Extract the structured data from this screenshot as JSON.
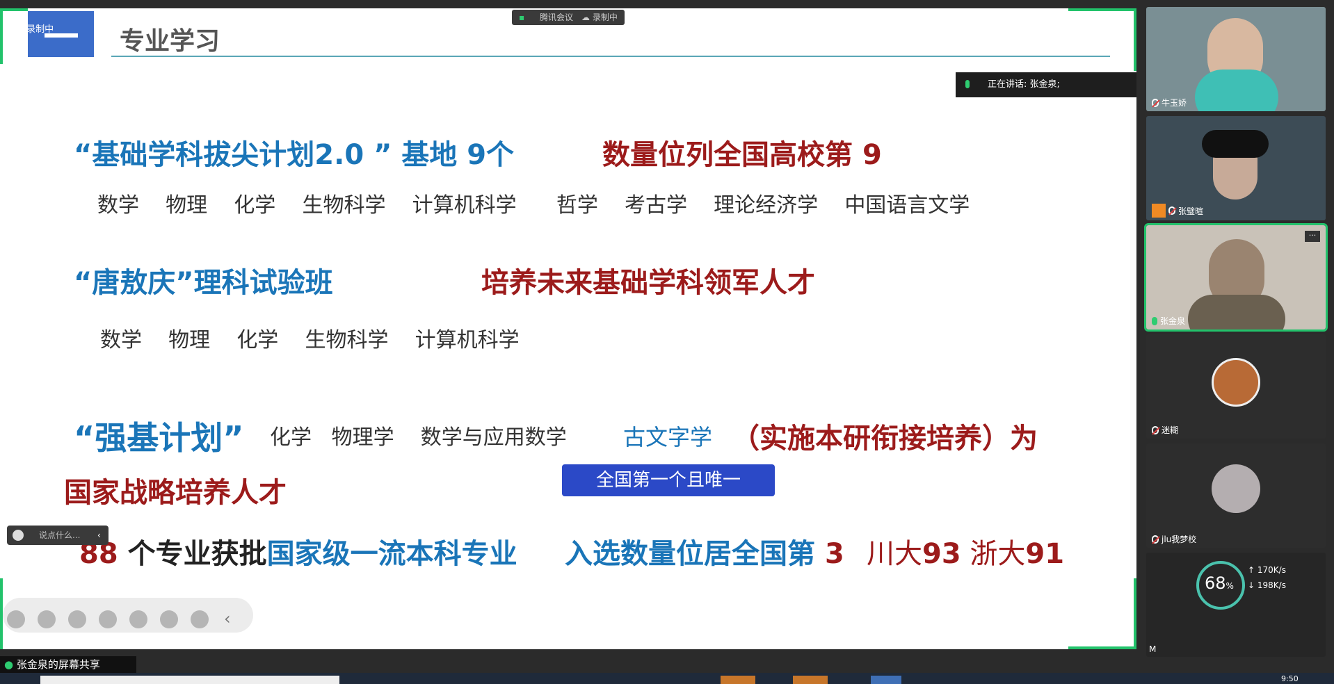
{
  "app": {
    "name": "腾讯会议",
    "recording": "录制中"
  },
  "slide": {
    "title": "专业学习",
    "recording_badge": "录制中",
    "speaking": "正在讲话: 张金泉;",
    "line1_blue": "“基础学科拔尖计划2.0 ” 基地 9个",
    "line1_red": "数量位列全国高校第",
    "line1_num": "9",
    "line1_subjects": [
      "数学",
      "物理",
      "化学",
      "生物科学",
      "计算机科学",
      "哲学",
      "考古学",
      "理论经济学",
      "中国语言文学"
    ],
    "line2_blue": "“唐敖庆”理科试验班",
    "line2_red": "培养未来基础学科领军人才",
    "line2_subjects": [
      "数学",
      "物理",
      "化学",
      "生物科学",
      "计算机科学"
    ],
    "line3_blue": "“强基计划”",
    "line3_subjects": [
      "化学",
      "物理学",
      "数学与应用数学"
    ],
    "line3_highlight": "古文字学",
    "line3_red": "（实施本研衔接培养）为",
    "line3_red2": "国家战略培养人才",
    "badge": "全国第一个且唯一",
    "line4_num": "88",
    "line4_a": " 个专业获批",
    "line4_b": "国家级一流本科专业",
    "line4_c": "入选数量位居全国第",
    "line4_d": "3",
    "line4_e1": "川大",
    "line4_e2": "93",
    "line4_e3": "浙大",
    "line4_e4": "91"
  },
  "chat_placeholder": "说点什么...",
  "participants": [
    {
      "name": "牛玉娇",
      "bg": "#7a8f94"
    },
    {
      "name": "张璧暄",
      "bg": "#3d4c56"
    },
    {
      "name": "张金泉",
      "bg": "#c9c2b8"
    },
    {
      "name": "迷糊",
      "bg": "#2d2d2d"
    },
    {
      "name": "jlu我梦校",
      "bg": "#2d2d2d"
    },
    {
      "name": "M",
      "bg": "#262626"
    }
  ],
  "net": {
    "percent": "68",
    "pct_sign": "%",
    "up": "170",
    "down": "198",
    "unit": "K/s"
  },
  "share_label": "张金泉的屏幕共享",
  "clock": "9:50"
}
